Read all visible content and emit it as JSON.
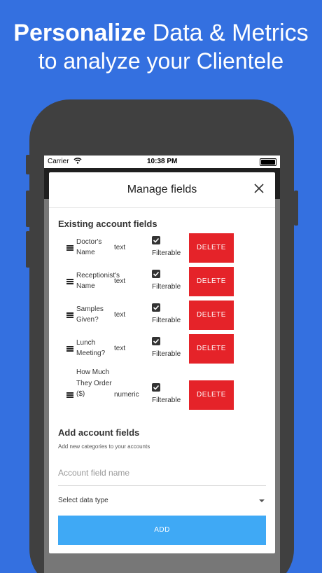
{
  "promo": {
    "line1_bold": "Personalize",
    "line1_rest": "Data & Metrics",
    "line2": "to analyze your Clientele"
  },
  "status_bar": {
    "carrier": "Carrier",
    "time": "10:38 PM"
  },
  "modal": {
    "title": "Manage fields",
    "existing_title": "Existing account fields",
    "fields": [
      {
        "name": "Doctor's Name",
        "type": "text",
        "filterable_label": "Filterable",
        "filterable_checked": true,
        "delete_label": "DELETE"
      },
      {
        "name": "Receptionist's Name",
        "type": "text",
        "filterable_label": "Filterable",
        "filterable_checked": true,
        "delete_label": "DELETE"
      },
      {
        "name": "Samples Given?",
        "type": "text",
        "filterable_label": "Filterable",
        "filterable_checked": true,
        "delete_label": "DELETE"
      },
      {
        "name": "Lunch Meeting?",
        "type": "text",
        "filterable_label": "Filterable",
        "filterable_checked": true,
        "delete_label": "DELETE"
      },
      {
        "name": "How Much They Order ($)",
        "type": "numeric",
        "filterable_label": "Filterable",
        "filterable_checked": true,
        "delete_label": "DELETE"
      }
    ],
    "add_title": "Add account fields",
    "add_description": "Add new categories to your accounts",
    "name_placeholder": "Account field name",
    "name_value": "",
    "data_type_label": "Select data type",
    "add_button": "ADD"
  },
  "colors": {
    "background": "#3470e0",
    "delete": "#e52329",
    "add": "#3fa9f5"
  }
}
